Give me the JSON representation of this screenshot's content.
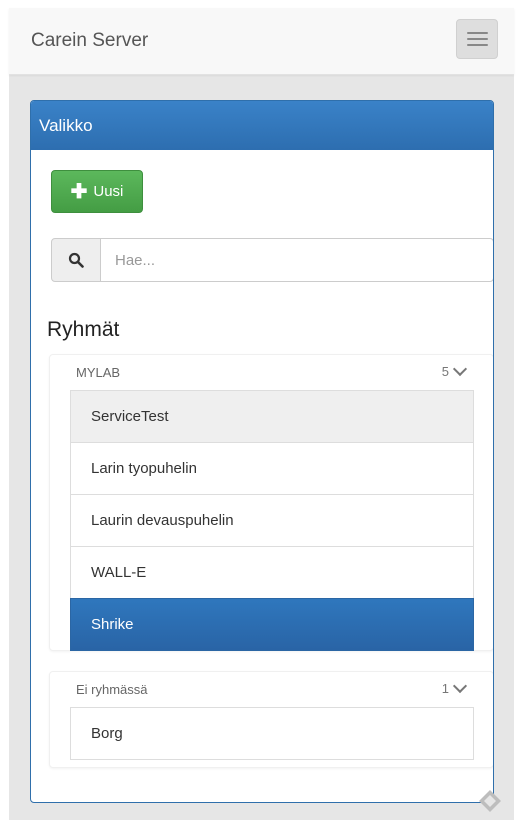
{
  "navbar": {
    "brand": "Carein Server",
    "menu_icon": "hamburger-icon"
  },
  "panel": {
    "heading": "Valikko",
    "new_button": {
      "icon": "plus-icon",
      "label": "Uusi"
    },
    "search": {
      "icon": "search-icon",
      "placeholder": "Hae...",
      "value": ""
    },
    "groups_title": "Ryhmät",
    "groups": [
      {
        "name": "MYLAB",
        "count": "5",
        "items": [
          {
            "label": "ServiceTest",
            "state": "hover"
          },
          {
            "label": "Larin tyopuhelin",
            "state": "normal"
          },
          {
            "label": "Laurin devauspuhelin",
            "state": "normal"
          },
          {
            "label": "WALL-E",
            "state": "normal"
          },
          {
            "label": "Shrike",
            "state": "active"
          }
        ]
      },
      {
        "name": "Ei ryhmässä",
        "count": "1",
        "items": [
          {
            "label": "Borg",
            "state": "normal"
          }
        ]
      }
    ]
  },
  "colors": {
    "primary": "#337ab7",
    "success": "#5cb85c",
    "active_item": "#2d6eb0",
    "background": "#e6e6e6"
  }
}
